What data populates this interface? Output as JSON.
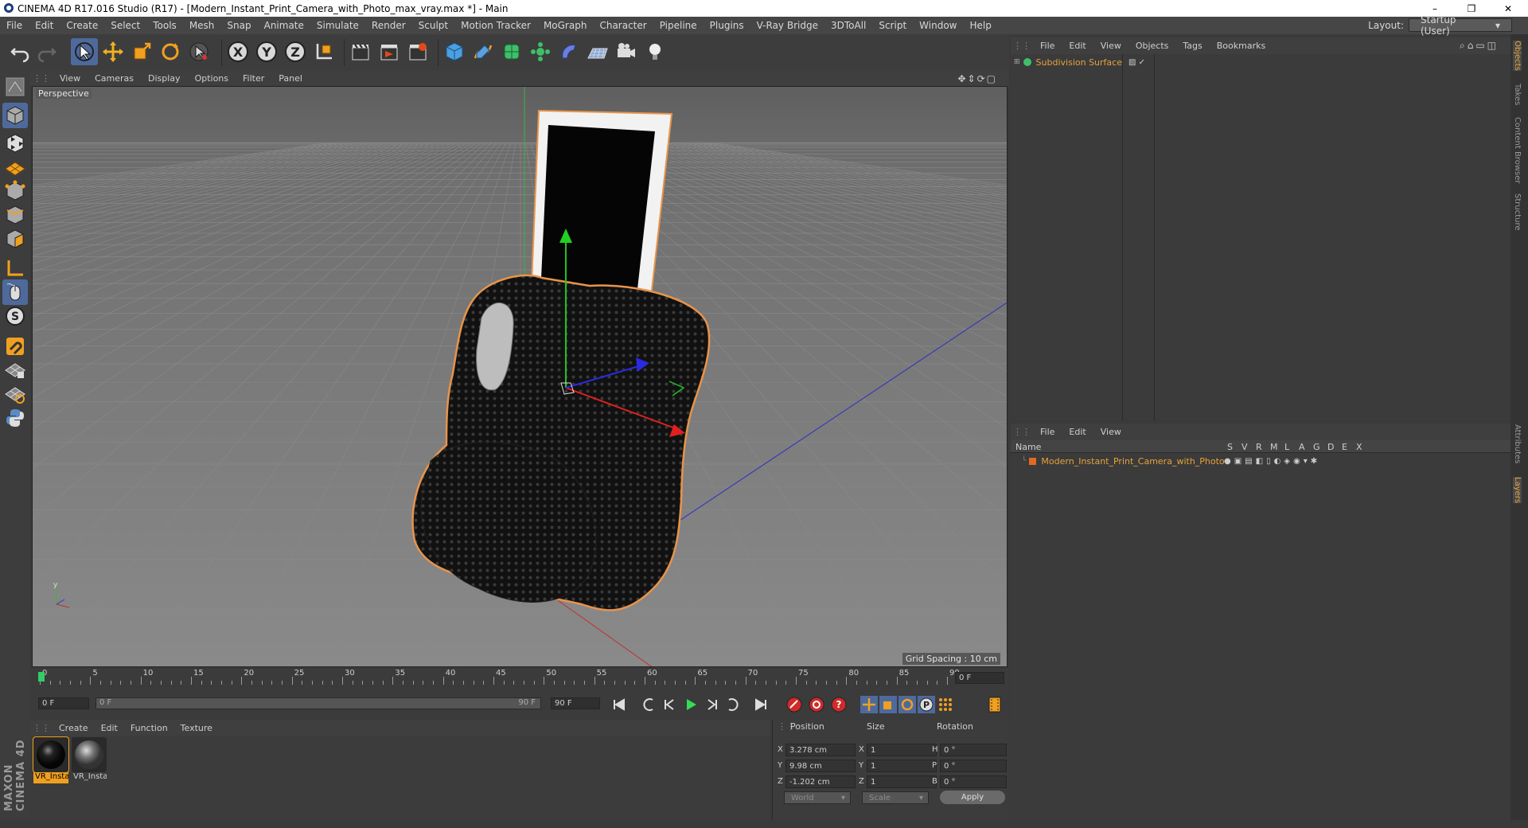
{
  "window": {
    "title": "CINEMA 4D R17.016 Studio (R17) - [Modern_Instant_Print_Camera_with_Photo_max_vray.max *] - Main",
    "minimize": "–",
    "restore": "❐",
    "close": "✕"
  },
  "menu": [
    "File",
    "Edit",
    "Create",
    "Select",
    "Tools",
    "Mesh",
    "Snap",
    "Animate",
    "Simulate",
    "Render",
    "Sculpt",
    "Motion Tracker",
    "MoGraph",
    "Character",
    "Pipeline",
    "Plugins",
    "V-Ray Bridge",
    "3DToAll",
    "Script",
    "Window",
    "Help"
  ],
  "layout": {
    "label": "Layout:",
    "value": "Startup (User)"
  },
  "viewport": {
    "menu": [
      "View",
      "Cameras",
      "Display",
      "Options",
      "Filter",
      "Panel"
    ],
    "label": "Perspective",
    "grid_spacing": "Grid Spacing : 10 cm"
  },
  "timeline": {
    "ticks": [
      "0",
      "5",
      "10",
      "15",
      "20",
      "25",
      "30",
      "35",
      "40",
      "45",
      "50",
      "55",
      "60",
      "65",
      "70",
      "75",
      "80",
      "85",
      "90"
    ],
    "current_frame": "0 F",
    "start_field": "0 F",
    "range_start": "0 F",
    "range_end": "90 F",
    "end_field": "90 F"
  },
  "materials": {
    "menu": [
      "Create",
      "Edit",
      "Function",
      "Texture"
    ],
    "items": [
      {
        "label": "VR_Insta"
      },
      {
        "label": "VR_Insta"
      }
    ]
  },
  "coordinates": {
    "headers": {
      "position": "Position",
      "size": "Size",
      "rotation": "Rotation"
    },
    "rows": [
      {
        "axis": "X",
        "pos": "3.278 cm",
        "size_axis": "X",
        "size": "1",
        "rot_axis": "H",
        "rot": "0 °"
      },
      {
        "axis": "Y",
        "pos": "9.98 cm",
        "size_axis": "Y",
        "size": "1",
        "rot_axis": "P",
        "rot": "0 °"
      },
      {
        "axis": "Z",
        "pos": "-1.202 cm",
        "size_axis": "Z",
        "size": "1",
        "rot_axis": "B",
        "rot": "0 °"
      }
    ],
    "space": "World",
    "mode": "Scale",
    "apply": "Apply"
  },
  "objects": {
    "menu": [
      "File",
      "Edit",
      "View",
      "Objects",
      "Tags",
      "Bookmarks"
    ],
    "items": [
      {
        "name": "Subdivision Surface"
      }
    ]
  },
  "layers": {
    "menu": [
      "File",
      "Edit",
      "View"
    ],
    "columns": [
      "Name",
      "S",
      "V",
      "R",
      "M",
      "L",
      "A",
      "G",
      "D",
      "E",
      "X"
    ],
    "items": [
      {
        "name": "Modern_Instant_Print_Camera_with_Photo"
      }
    ]
  },
  "side_tabs": [
    "Objects",
    "Takes",
    "Content Browser",
    "Structure",
    "Attributes",
    "Layers"
  ],
  "branding": "MAXON CINEMA 4D",
  "colors": {
    "accent": "#4e6a9c",
    "selection": "#e89a3c",
    "object_name": "#e8a33a"
  }
}
